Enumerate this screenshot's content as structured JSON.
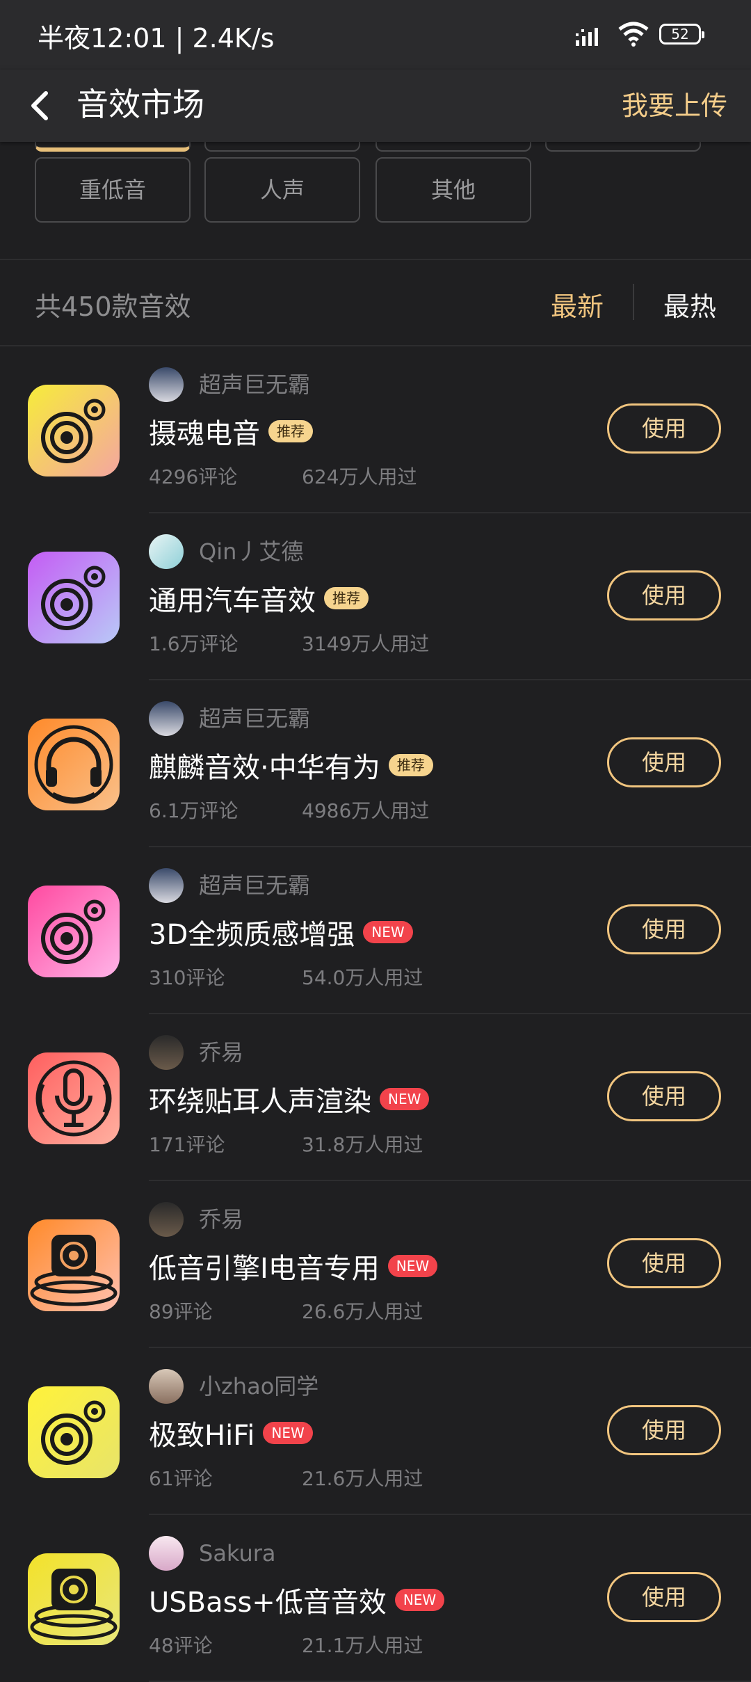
{
  "status_bar": {
    "time": "半夜12:01 | 2.4K/s",
    "battery": "52"
  },
  "header": {
    "title": "音效市场",
    "upload_label": "我要上传"
  },
  "categories": {
    "visible": [
      "重低音",
      "人声",
      "其他"
    ]
  },
  "summary": {
    "count_text": "共450款音效",
    "sort_new": "最新",
    "sort_hot": "最热"
  },
  "colors": {
    "accent": "#f1c57f",
    "badge_recommend": "#f6d48e",
    "badge_new": "#f2434b"
  },
  "items": [
    {
      "author": "超声巨无霸",
      "title": "摄魂电音",
      "badge": "推荐",
      "badge_type": "recommend",
      "comments": "4296评论",
      "users": "624万人用过",
      "use_label": "使用",
      "icon": "camera-speaker-icon"
    },
    {
      "author": "Qin丿艾德",
      "title": "通用汽车音效",
      "badge": "推荐",
      "badge_type": "recommend",
      "comments": "1.6万评论",
      "users": "3149万人用过",
      "use_label": "使用",
      "icon": "camera-speaker-icon"
    },
    {
      "author": "超声巨无霸",
      "title": "麒麟音效·中华有为",
      "badge": "推荐",
      "badge_type": "recommend",
      "comments": "6.1万评论",
      "users": "4986万人用过",
      "use_label": "使用",
      "icon": "headphones-icon"
    },
    {
      "author": "超声巨无霸",
      "title": "3D全频质感增强",
      "badge": "NEW",
      "badge_type": "new",
      "comments": "310评论",
      "users": "54.0万人用过",
      "use_label": "使用",
      "icon": "camera-speaker-icon"
    },
    {
      "author": "乔易",
      "title": "环绕贴耳人声渲染",
      "badge": "NEW",
      "badge_type": "new",
      "comments": "171评论",
      "users": "31.8万人用过",
      "use_label": "使用",
      "icon": "microphone-icon"
    },
    {
      "author": "乔易",
      "title": "低音引擎I电音专用",
      "badge": "NEW",
      "badge_type": "new",
      "comments": "89评论",
      "users": "26.6万人用过",
      "use_label": "使用",
      "icon": "subwoofer-icon"
    },
    {
      "author": "小zhao同学",
      "title": "极致HiFi",
      "badge": "NEW",
      "badge_type": "new",
      "comments": "61评论",
      "users": "21.6万人用过",
      "use_label": "使用",
      "icon": "camera-speaker-icon"
    },
    {
      "author": "Sakura",
      "title": "USBass+低音音效",
      "badge": "NEW",
      "badge_type": "new",
      "comments": "48评论",
      "users": "21.1万人用过",
      "use_label": "使用",
      "icon": "subwoofer-icon"
    }
  ]
}
